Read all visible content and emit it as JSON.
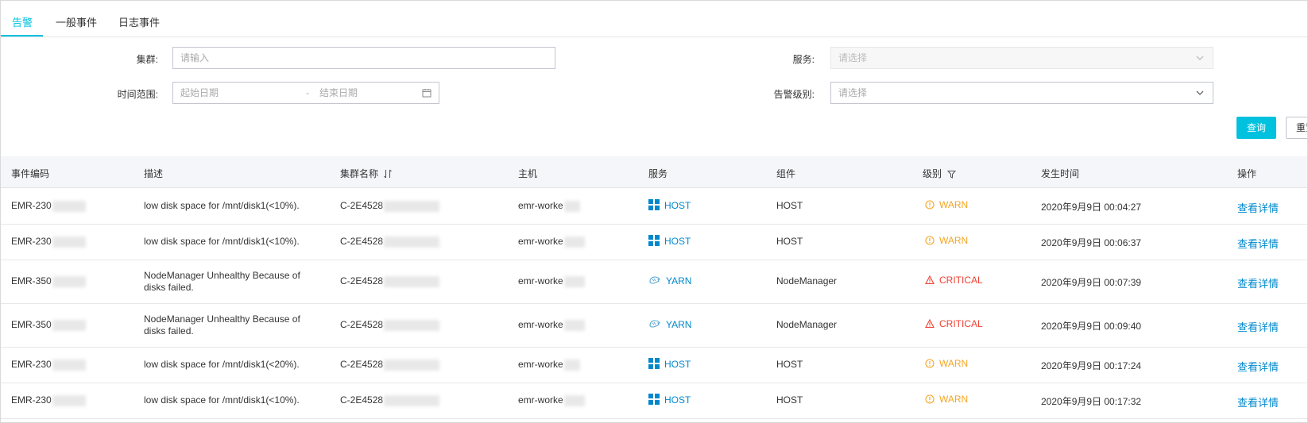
{
  "tabs": [
    {
      "label": "告警",
      "active": true
    },
    {
      "label": "一般事件",
      "active": false
    },
    {
      "label": "日志事件",
      "active": false
    }
  ],
  "filters": {
    "cluster_label": "集群:",
    "cluster_placeholder": "请输入",
    "service_label": "服务:",
    "service_placeholder": "请选择",
    "time_label": "时间范围:",
    "start_placeholder": "起始日期",
    "date_sep": "-",
    "end_placeholder": "结束日期",
    "level_label": "告警级别:",
    "level_placeholder": "请选择",
    "query_button": "查询",
    "reset_button": "重置"
  },
  "table": {
    "columns": [
      "事件编码",
      "描述",
      "集群名称",
      "主机",
      "服务",
      "组件",
      "级别",
      "发生时间",
      "操作"
    ],
    "rows": [
      {
        "code": "EMR-230",
        "desc": "low disk space for /mnt/disk1(<10%).",
        "cluster": "C-2E4528",
        "host": "emr-worke",
        "service": "HOST",
        "component": "HOST",
        "level": "WARN",
        "time": "2020年9月9日 00:04:27",
        "action": "查看详情"
      },
      {
        "code": "EMR-230",
        "desc": "low disk space for /mnt/disk1(<10%).",
        "cluster": "C-2E4528",
        "host": "emr-worke",
        "service": "HOST",
        "component": "HOST",
        "level": "WARN",
        "time": "2020年9月9日 00:06:37",
        "action": "查看详情"
      },
      {
        "code": "EMR-350",
        "desc": "NodeManager Unhealthy Because of disks failed.",
        "cluster": "C-2E4528",
        "host": "emr-worke",
        "service": "YARN",
        "component": "NodeManager",
        "level": "CRITICAL",
        "time": "2020年9月9日 00:07:39",
        "action": "查看详情"
      },
      {
        "code": "EMR-350",
        "desc": "NodeManager Unhealthy Because of disks failed.",
        "cluster": "C-2E4528",
        "host": "emr-worke",
        "service": "YARN",
        "component": "NodeManager",
        "level": "CRITICAL",
        "time": "2020年9月9日 00:09:40",
        "action": "查看详情"
      },
      {
        "code": "EMR-230",
        "desc": "low disk space for /mnt/disk1(<20%).",
        "cluster": "C-2E4528",
        "host": "emr-worke",
        "service": "HOST",
        "component": "HOST",
        "level": "WARN",
        "time": "2020年9月9日 00:17:24",
        "action": "查看详情"
      },
      {
        "code": "EMR-230",
        "desc": "low disk space for /mnt/disk1(<10%).",
        "cluster": "C-2E4528",
        "host": "emr-worke",
        "service": "HOST",
        "component": "HOST",
        "level": "WARN",
        "time": "2020年9月9日 00:17:32",
        "action": "查看详情"
      }
    ]
  },
  "colors": {
    "accent": "#00c1de",
    "link": "#0088cc",
    "warn": "#f5a623",
    "critical": "#f04134"
  },
  "icons": {
    "host_service": "grid-icon",
    "yarn_service": "yarn-icon",
    "warn_level": "info-circle-icon",
    "critical_level": "warning-triangle-icon",
    "sort": "sort-icon",
    "filter": "filter-icon",
    "calendar": "calendar-icon",
    "dropdown": "chevron-down-icon"
  }
}
